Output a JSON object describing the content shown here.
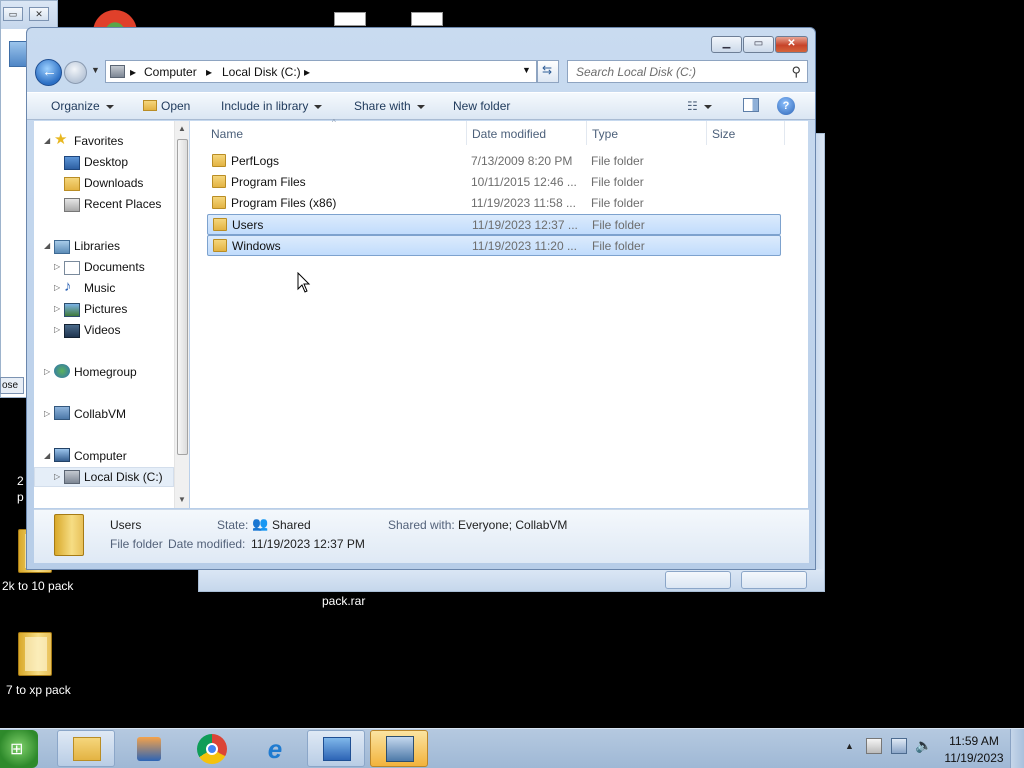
{
  "background": {
    "left_window_close_label": "ose",
    "bottom_file_label": "pack.rar"
  },
  "desktop": {
    "icons": [
      {
        "label": "2k to 10 pack"
      },
      {
        "label": "7 to xp pack"
      }
    ],
    "partial_labels": [
      "2",
      "p"
    ]
  },
  "explorer": {
    "breadcrumb": [
      "Computer",
      "Local Disk (C:)"
    ],
    "search_placeholder": "Search Local Disk (C:)",
    "toolbar": {
      "organize": "Organize",
      "open": "Open",
      "include_in_library": "Include in library",
      "share_with": "Share with",
      "new_folder": "New folder"
    },
    "nav": {
      "favorites": "Favorites",
      "desktop": "Desktop",
      "downloads": "Downloads",
      "recent_places": "Recent Places",
      "libraries": "Libraries",
      "documents": "Documents",
      "music": "Music",
      "pictures": "Pictures",
      "videos": "Videos",
      "homegroup": "Homegroup",
      "collabvm": "CollabVM",
      "computer": "Computer",
      "local_disk": "Local Disk (C:)"
    },
    "columns": {
      "name": "Name",
      "date_modified": "Date modified",
      "type": "Type",
      "size": "Size"
    },
    "files": [
      {
        "name": "PerfLogs",
        "date": "7/13/2009 8:20 PM",
        "type": "File folder"
      },
      {
        "name": "Program Files",
        "date": "10/11/2015 12:46 ...",
        "type": "File folder"
      },
      {
        "name": "Program Files (x86)",
        "date": "11/19/2023 11:58 ...",
        "type": "File folder"
      },
      {
        "name": "Users",
        "date": "11/19/2023 12:37 ...",
        "type": "File folder"
      },
      {
        "name": "Windows",
        "date": "11/19/2023 11:20 ...",
        "type": "File folder"
      }
    ],
    "details": {
      "name": "Users",
      "kind": "File folder",
      "state_label": "State:",
      "state_value": "Shared",
      "shared_with_label": "Shared with:",
      "shared_with_value": "Everyone; CollabVM",
      "date_label": "Date modified:",
      "date_value": "11/19/2023 12:37 PM"
    }
  },
  "taskbar": {
    "time": "11:59 AM",
    "date": "11/19/2023"
  },
  "colors": {
    "selection": "#cce4fc",
    "window_frame": "#b9d1ea",
    "taskbar": "#a9c0dc"
  }
}
